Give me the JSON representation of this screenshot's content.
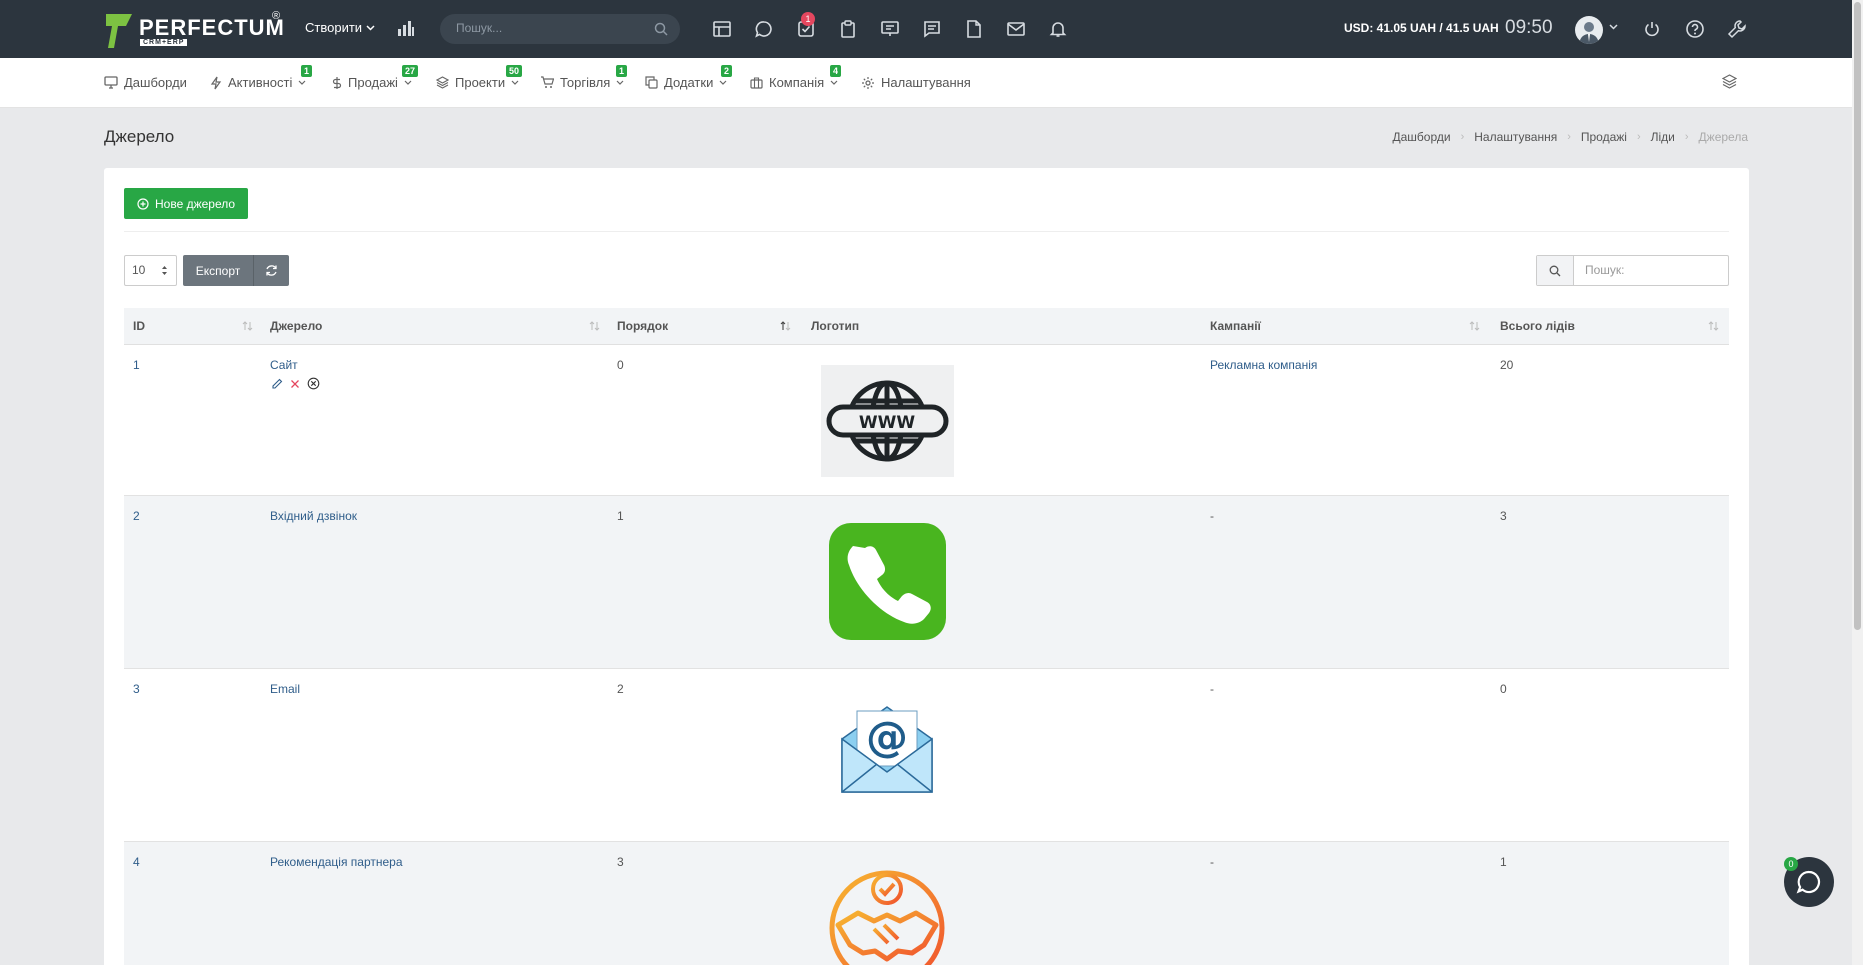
{
  "topbar": {
    "brand": "PERFECTUM",
    "brand_reg": "®",
    "brand_sub": "CRM+ERP",
    "create_label": "Створити",
    "search_placeholder": "Пошук...",
    "tasks_badge": "1",
    "currency": "USD: 41.05 UAH / 41.5 UAH",
    "time": "09:50"
  },
  "nav": {
    "items": [
      {
        "label": "Дашборди",
        "icon": "monitor-icon",
        "badge": ""
      },
      {
        "label": "Активності",
        "icon": "bolt-icon",
        "badge": "1"
      },
      {
        "label": "Продажі",
        "icon": "dollar-icon",
        "badge": "27"
      },
      {
        "label": "Проекти",
        "icon": "layers-icon",
        "badge": "50"
      },
      {
        "label": "Торгівля",
        "icon": "cart-icon",
        "badge": "1"
      },
      {
        "label": "Додатки",
        "icon": "copy-icon",
        "badge": "2"
      },
      {
        "label": "Компанія",
        "icon": "briefcase-icon",
        "badge": "4"
      },
      {
        "label": "Налаштування",
        "icon": "gear-icon",
        "badge": ""
      }
    ]
  },
  "page": {
    "title": "Джерело",
    "breadcrumb": [
      "Дашборди",
      "Налаштування",
      "Продажі",
      "Ліди",
      "Джерела"
    ]
  },
  "toolbar": {
    "new_label": "Нове джерело",
    "page_length": "10",
    "export_label": "Експорт",
    "search_placeholder": "Пошук:"
  },
  "table": {
    "columns": [
      "ID",
      "Джерело",
      "Порядок",
      "Логотип",
      "Кампанії",
      "Всього лідів"
    ],
    "rows": [
      {
        "id": "1",
        "source": "Сайт",
        "order": "0",
        "logo": "www-globe-icon",
        "campaign": "Рекламна компанія",
        "total": "20"
      },
      {
        "id": "2",
        "source": "Вхідний дзвінок",
        "order": "1",
        "logo": "phone-icon",
        "campaign": "-",
        "total": "3"
      },
      {
        "id": "3",
        "source": "Email",
        "order": "2",
        "logo": "email-envelope-icon",
        "campaign": "-",
        "total": "0"
      },
      {
        "id": "4",
        "source": "Рекомендація партнера",
        "order": "3",
        "logo": "handshake-icon",
        "campaign": "-",
        "total": "1"
      }
    ]
  },
  "chat": {
    "badge": "0"
  },
  "colors": {
    "topbar": "#2c353e",
    "accent_green": "#28a745",
    "link": "#2f5d8a",
    "badge_red": "#e5475f"
  }
}
